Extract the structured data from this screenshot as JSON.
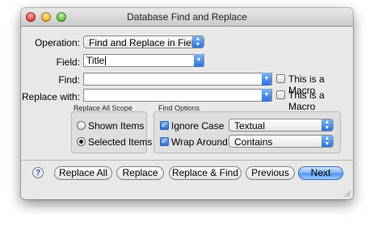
{
  "window": {
    "title": "Database Find and Replace"
  },
  "operation": {
    "label": "Operation:",
    "value": "Find and Replace in Field"
  },
  "field": {
    "label": "Field:",
    "value": "Title"
  },
  "find": {
    "label": "Find:",
    "value": "",
    "macro_label": "This is a Macro",
    "macro_checked": false
  },
  "replace_with": {
    "label": "Replace with:",
    "value": "",
    "macro_label": "This is a Macro",
    "macro_checked": false
  },
  "scope": {
    "title": "Replace All Scope",
    "options": [
      {
        "label": "Shown Items",
        "selected": false
      },
      {
        "label": "Selected Items",
        "selected": true
      }
    ]
  },
  "find_options": {
    "title": "Find Options",
    "ignore_case": {
      "label": "Ignore Case",
      "checked": true,
      "mode": "Textual"
    },
    "wrap_around": {
      "label": "Wrap Around",
      "checked": true,
      "mode": "Contains"
    }
  },
  "buttons": {
    "help": "?",
    "replace_all": "Replace All",
    "replace": "Replace",
    "replace_find": "Replace & Find",
    "previous": "Previous",
    "next": "Next"
  }
}
